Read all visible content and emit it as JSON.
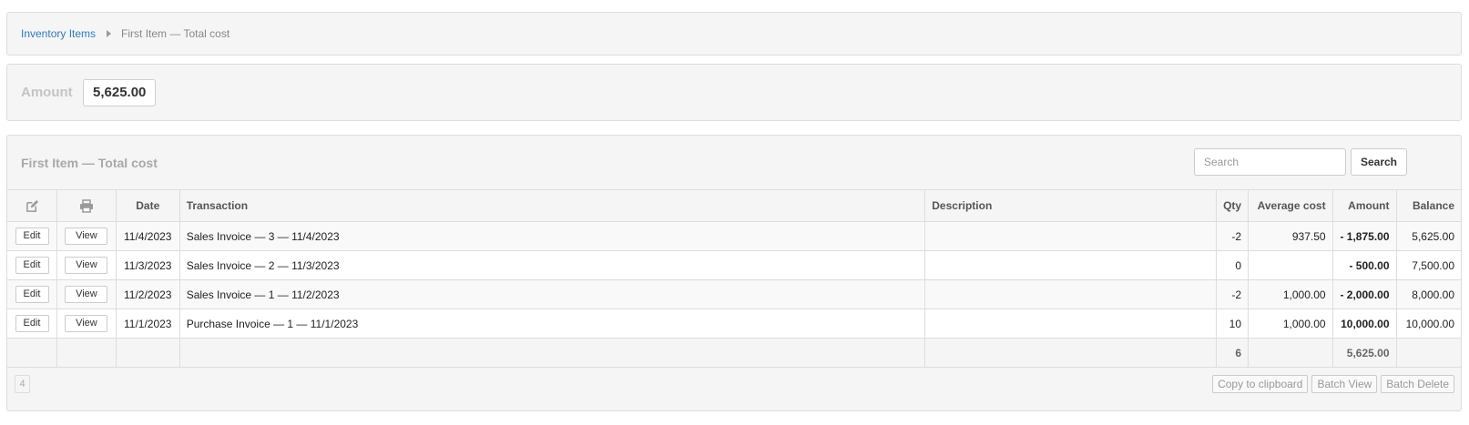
{
  "breadcrumb": {
    "link": "Inventory Items",
    "current": "First Item — Total cost"
  },
  "amount": {
    "label": "Amount",
    "value": "5,625.00"
  },
  "table_panel": {
    "title": "First Item — Total cost",
    "search_placeholder": "Search",
    "search_button": "Search"
  },
  "columns": {
    "edit_icon": "edit-icon",
    "print_icon": "print-icon",
    "date": "Date",
    "transaction": "Transaction",
    "description": "Description",
    "qty": "Qty",
    "average_cost": "Average cost",
    "amount": "Amount",
    "balance": "Balance"
  },
  "rows": [
    {
      "edit": "Edit",
      "view": "View",
      "date": "11/4/2023",
      "transaction": "Sales Invoice — 3 — 11/4/2023",
      "description": "",
      "qty": "-2",
      "average_cost": "937.50",
      "amount": "- 1,875.00",
      "balance": "5,625.00"
    },
    {
      "edit": "Edit",
      "view": "View",
      "date": "11/3/2023",
      "transaction": "Sales Invoice — 2 — 11/3/2023",
      "description": "",
      "qty": "0",
      "average_cost": "",
      "amount": "- 500.00",
      "balance": "7,500.00"
    },
    {
      "edit": "Edit",
      "view": "View",
      "date": "11/2/2023",
      "transaction": "Sales Invoice — 1 — 11/2/2023",
      "description": "",
      "qty": "-2",
      "average_cost": "1,000.00",
      "amount": "- 2,000.00",
      "balance": "8,000.00"
    },
    {
      "edit": "Edit",
      "view": "View",
      "date": "11/1/2023",
      "transaction": "Purchase Invoice — 1 — 11/1/2023",
      "description": "",
      "qty": "10",
      "average_cost": "1,000.00",
      "amount": "10,000.00",
      "balance": "10,000.00"
    }
  ],
  "totals": {
    "qty": "6",
    "amount": "5,625.00"
  },
  "footer": {
    "count": "4",
    "copy": "Copy to clipboard",
    "batch_view": "Batch View",
    "batch_delete": "Batch Delete"
  },
  "colors": {
    "link": "#337ab7",
    "negative": "#e00000",
    "panel_bg": "#f5f5f5"
  }
}
